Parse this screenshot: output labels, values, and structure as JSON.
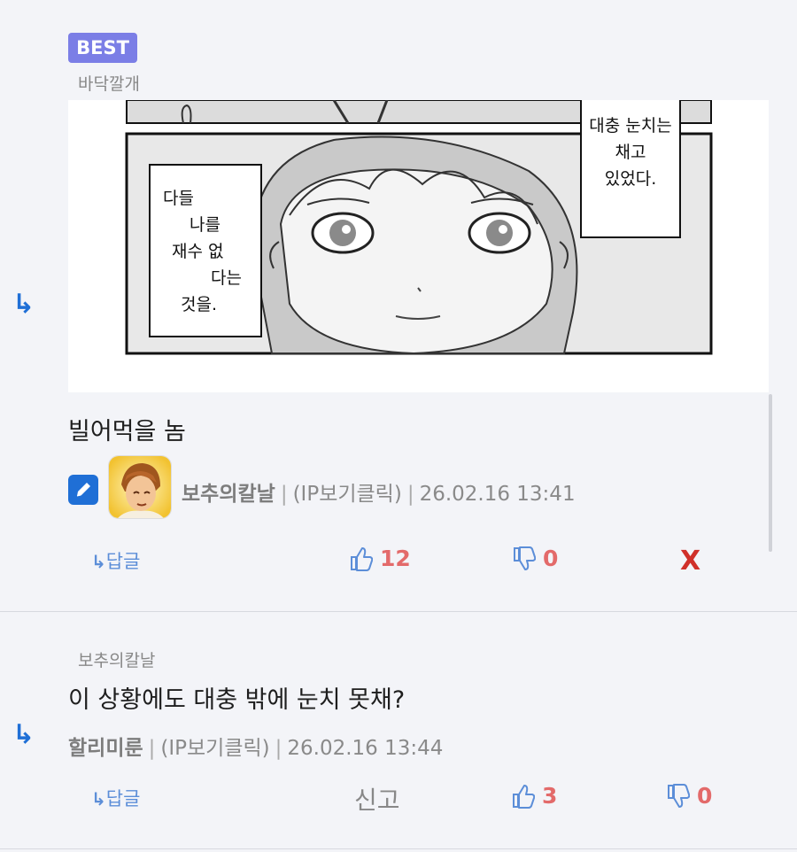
{
  "comment1": {
    "badge": "BEST",
    "reply_to": "바닥깔개",
    "manga": {
      "bubble_left": [
        "다들",
        "나를",
        "재수 없",
        "다는",
        "것을."
      ],
      "bubble_right": [
        "대충 눈치는",
        "채고",
        "있었다."
      ]
    },
    "text": "빌어먹을 놈",
    "author": "보추의칼날",
    "ip": "(IP보기클릭)",
    "datetime": "26.02.16 13:41",
    "reply_label": "답글",
    "upvotes": "12",
    "downvotes": "0",
    "delete_label": "X"
  },
  "comment2": {
    "reply_to": "보추의칼날",
    "text": "이 상황에도 대충 밖에 눈치 못채?",
    "author": "할리미룬",
    "ip": "(IP보기클릭)",
    "datetime": "26.02.16 13:44",
    "reply_label": "답글",
    "report_label": "신고",
    "upvotes": "3",
    "downvotes": "0"
  },
  "colors": {
    "accent": "#1f6fd6",
    "best_badge": "#7b7ee6",
    "vote": "#e36a6a",
    "thumb_icon": "#5c8ed8",
    "delete": "#d0302a"
  }
}
